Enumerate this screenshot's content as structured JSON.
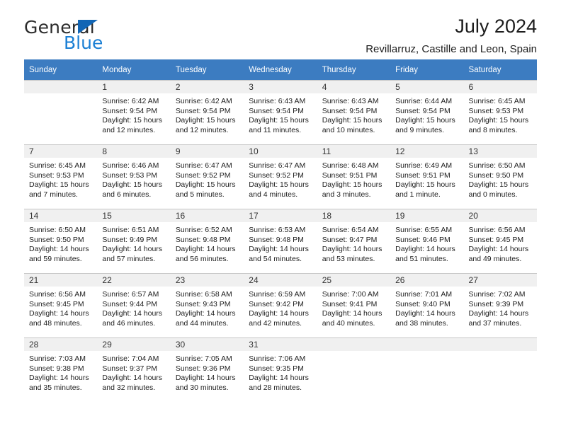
{
  "brand": {
    "name_part1": "General",
    "name_part2": "Blue",
    "accent_color": "#1a7fd4",
    "triangle_color": "#1266b5"
  },
  "header": {
    "title": "July 2024",
    "subtitle": "Revillarruz, Castille and Leon, Spain",
    "header_band_color": "#3c7cc1"
  },
  "calendar": {
    "weekdays": [
      "Sunday",
      "Monday",
      "Tuesday",
      "Wednesday",
      "Thursday",
      "Friday",
      "Saturday"
    ],
    "weeks": [
      [
        {
          "day": "",
          "sunrise": "",
          "sunset": "",
          "daylight1": "",
          "daylight2": ""
        },
        {
          "day": "1",
          "sunrise": "Sunrise: 6:42 AM",
          "sunset": "Sunset: 9:54 PM",
          "daylight1": "Daylight: 15 hours",
          "daylight2": "and 12 minutes."
        },
        {
          "day": "2",
          "sunrise": "Sunrise: 6:42 AM",
          "sunset": "Sunset: 9:54 PM",
          "daylight1": "Daylight: 15 hours",
          "daylight2": "and 12 minutes."
        },
        {
          "day": "3",
          "sunrise": "Sunrise: 6:43 AM",
          "sunset": "Sunset: 9:54 PM",
          "daylight1": "Daylight: 15 hours",
          "daylight2": "and 11 minutes."
        },
        {
          "day": "4",
          "sunrise": "Sunrise: 6:43 AM",
          "sunset": "Sunset: 9:54 PM",
          "daylight1": "Daylight: 15 hours",
          "daylight2": "and 10 minutes."
        },
        {
          "day": "5",
          "sunrise": "Sunrise: 6:44 AM",
          "sunset": "Sunset: 9:54 PM",
          "daylight1": "Daylight: 15 hours",
          "daylight2": "and 9 minutes."
        },
        {
          "day": "6",
          "sunrise": "Sunrise: 6:45 AM",
          "sunset": "Sunset: 9:53 PM",
          "daylight1": "Daylight: 15 hours",
          "daylight2": "and 8 minutes."
        }
      ],
      [
        {
          "day": "7",
          "sunrise": "Sunrise: 6:45 AM",
          "sunset": "Sunset: 9:53 PM",
          "daylight1": "Daylight: 15 hours",
          "daylight2": "and 7 minutes."
        },
        {
          "day": "8",
          "sunrise": "Sunrise: 6:46 AM",
          "sunset": "Sunset: 9:53 PM",
          "daylight1": "Daylight: 15 hours",
          "daylight2": "and 6 minutes."
        },
        {
          "day": "9",
          "sunrise": "Sunrise: 6:47 AM",
          "sunset": "Sunset: 9:52 PM",
          "daylight1": "Daylight: 15 hours",
          "daylight2": "and 5 minutes."
        },
        {
          "day": "10",
          "sunrise": "Sunrise: 6:47 AM",
          "sunset": "Sunset: 9:52 PM",
          "daylight1": "Daylight: 15 hours",
          "daylight2": "and 4 minutes."
        },
        {
          "day": "11",
          "sunrise": "Sunrise: 6:48 AM",
          "sunset": "Sunset: 9:51 PM",
          "daylight1": "Daylight: 15 hours",
          "daylight2": "and 3 minutes."
        },
        {
          "day": "12",
          "sunrise": "Sunrise: 6:49 AM",
          "sunset": "Sunset: 9:51 PM",
          "daylight1": "Daylight: 15 hours",
          "daylight2": "and 1 minute."
        },
        {
          "day": "13",
          "sunrise": "Sunrise: 6:50 AM",
          "sunset": "Sunset: 9:50 PM",
          "daylight1": "Daylight: 15 hours",
          "daylight2": "and 0 minutes."
        }
      ],
      [
        {
          "day": "14",
          "sunrise": "Sunrise: 6:50 AM",
          "sunset": "Sunset: 9:50 PM",
          "daylight1": "Daylight: 14 hours",
          "daylight2": "and 59 minutes."
        },
        {
          "day": "15",
          "sunrise": "Sunrise: 6:51 AM",
          "sunset": "Sunset: 9:49 PM",
          "daylight1": "Daylight: 14 hours",
          "daylight2": "and 57 minutes."
        },
        {
          "day": "16",
          "sunrise": "Sunrise: 6:52 AM",
          "sunset": "Sunset: 9:48 PM",
          "daylight1": "Daylight: 14 hours",
          "daylight2": "and 56 minutes."
        },
        {
          "day": "17",
          "sunrise": "Sunrise: 6:53 AM",
          "sunset": "Sunset: 9:48 PM",
          "daylight1": "Daylight: 14 hours",
          "daylight2": "and 54 minutes."
        },
        {
          "day": "18",
          "sunrise": "Sunrise: 6:54 AM",
          "sunset": "Sunset: 9:47 PM",
          "daylight1": "Daylight: 14 hours",
          "daylight2": "and 53 minutes."
        },
        {
          "day": "19",
          "sunrise": "Sunrise: 6:55 AM",
          "sunset": "Sunset: 9:46 PM",
          "daylight1": "Daylight: 14 hours",
          "daylight2": "and 51 minutes."
        },
        {
          "day": "20",
          "sunrise": "Sunrise: 6:56 AM",
          "sunset": "Sunset: 9:45 PM",
          "daylight1": "Daylight: 14 hours",
          "daylight2": "and 49 minutes."
        }
      ],
      [
        {
          "day": "21",
          "sunrise": "Sunrise: 6:56 AM",
          "sunset": "Sunset: 9:45 PM",
          "daylight1": "Daylight: 14 hours",
          "daylight2": "and 48 minutes."
        },
        {
          "day": "22",
          "sunrise": "Sunrise: 6:57 AM",
          "sunset": "Sunset: 9:44 PM",
          "daylight1": "Daylight: 14 hours",
          "daylight2": "and 46 minutes."
        },
        {
          "day": "23",
          "sunrise": "Sunrise: 6:58 AM",
          "sunset": "Sunset: 9:43 PM",
          "daylight1": "Daylight: 14 hours",
          "daylight2": "and 44 minutes."
        },
        {
          "day": "24",
          "sunrise": "Sunrise: 6:59 AM",
          "sunset": "Sunset: 9:42 PM",
          "daylight1": "Daylight: 14 hours",
          "daylight2": "and 42 minutes."
        },
        {
          "day": "25",
          "sunrise": "Sunrise: 7:00 AM",
          "sunset": "Sunset: 9:41 PM",
          "daylight1": "Daylight: 14 hours",
          "daylight2": "and 40 minutes."
        },
        {
          "day": "26",
          "sunrise": "Sunrise: 7:01 AM",
          "sunset": "Sunset: 9:40 PM",
          "daylight1": "Daylight: 14 hours",
          "daylight2": "and 38 minutes."
        },
        {
          "day": "27",
          "sunrise": "Sunrise: 7:02 AM",
          "sunset": "Sunset: 9:39 PM",
          "daylight1": "Daylight: 14 hours",
          "daylight2": "and 37 minutes."
        }
      ],
      [
        {
          "day": "28",
          "sunrise": "Sunrise: 7:03 AM",
          "sunset": "Sunset: 9:38 PM",
          "daylight1": "Daylight: 14 hours",
          "daylight2": "and 35 minutes."
        },
        {
          "day": "29",
          "sunrise": "Sunrise: 7:04 AM",
          "sunset": "Sunset: 9:37 PM",
          "daylight1": "Daylight: 14 hours",
          "daylight2": "and 32 minutes."
        },
        {
          "day": "30",
          "sunrise": "Sunrise: 7:05 AM",
          "sunset": "Sunset: 9:36 PM",
          "daylight1": "Daylight: 14 hours",
          "daylight2": "and 30 minutes."
        },
        {
          "day": "31",
          "sunrise": "Sunrise: 7:06 AM",
          "sunset": "Sunset: 9:35 PM",
          "daylight1": "Daylight: 14 hours",
          "daylight2": "and 28 minutes."
        },
        {
          "day": "",
          "sunrise": "",
          "sunset": "",
          "daylight1": "",
          "daylight2": ""
        },
        {
          "day": "",
          "sunrise": "",
          "sunset": "",
          "daylight1": "",
          "daylight2": ""
        },
        {
          "day": "",
          "sunrise": "",
          "sunset": "",
          "daylight1": "",
          "daylight2": ""
        }
      ]
    ]
  }
}
